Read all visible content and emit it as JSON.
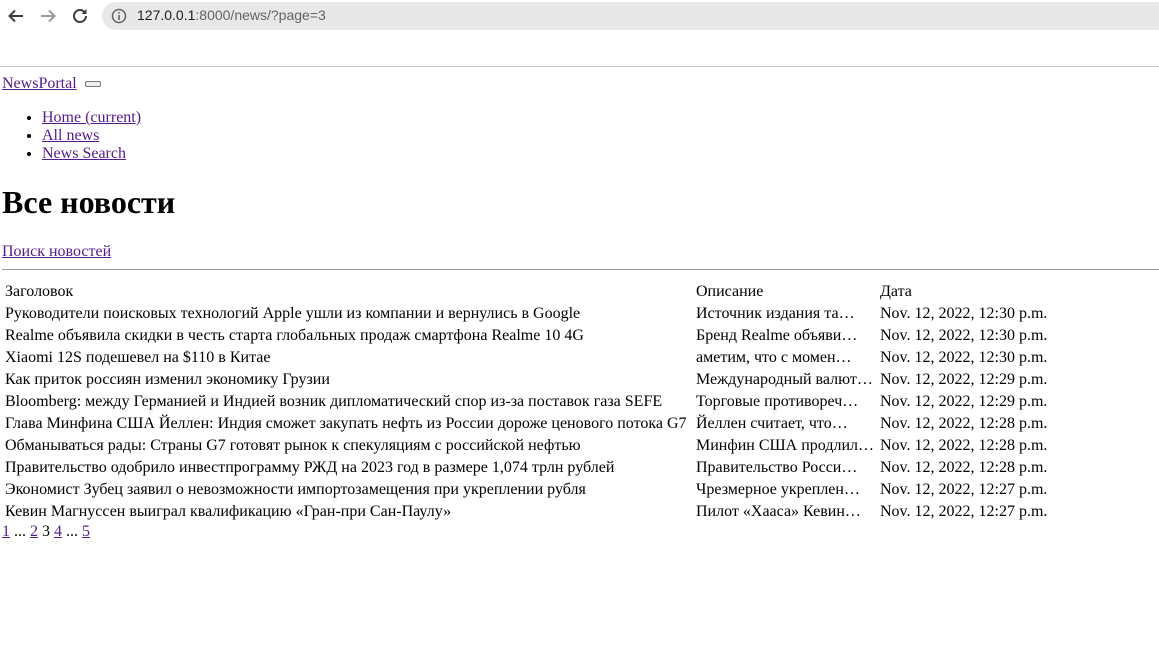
{
  "browser": {
    "url_host": "127.0.0.1",
    "url_path": ":8000/news/?page=3"
  },
  "navbar": {
    "brand": "NewsPortal",
    "items": [
      {
        "label": "Home (current)"
      },
      {
        "label": "All news"
      },
      {
        "label": "News Search"
      }
    ]
  },
  "main": {
    "title": "Все новости",
    "search_link": "Поиск новостей"
  },
  "table": {
    "headers": [
      "Заголовок",
      "Описание",
      "Дата"
    ],
    "rows": [
      {
        "title": "Руководители поисковых технологий Apple ушли из компании и вернулись в Google",
        "desc": "Источник издания та…",
        "date": "Nov. 12, 2022, 12:30 p.m."
      },
      {
        "title": "Realme объявила скидки в честь старта глобальных продаж смартфона Realme 10 4G",
        "desc": "Бренд Realme объяви…",
        "date": "Nov. 12, 2022, 12:30 p.m."
      },
      {
        "title": "Xiaomi 12S подешевел на $110 в Китае",
        "desc": "аметим, что с момен…",
        "date": "Nov. 12, 2022, 12:30 p.m."
      },
      {
        "title": "Как приток россиян изменил экономику Грузии",
        "desc": "Международный валют…",
        "date": "Nov. 12, 2022, 12:29 p.m."
      },
      {
        "title": "Bloomberg: между Германией и Индией возник дипломатический спор из-за поставок газа SEFE",
        "desc": "Торговые противореч…",
        "date": "Nov. 12, 2022, 12:29 p.m."
      },
      {
        "title": "Глава Минфина США Йеллен: Индия сможет закупать нефть из России дороже ценового потока G7",
        "desc": "Йеллен считает, что…",
        "date": "Nov. 12, 2022, 12:28 p.m."
      },
      {
        "title": "Обманываться рады: Страны G7 готовят рынок к спекуляциям с российской нефтью",
        "desc": "Минфин США продлил …",
        "date": "Nov. 12, 2022, 12:28 p.m."
      },
      {
        "title": "Правительство одобрило инвестпрограмму РЖД на 2023 год в размере 1,074 трлн рублей",
        "desc": "Правительство Росси…",
        "date": "Nov. 12, 2022, 12:28 p.m."
      },
      {
        "title": "Экономист Зубец заявил о невозможности импортозамещения при укреплении рубля",
        "desc": "Чрезмерное укреплен…",
        "date": "Nov. 12, 2022, 12:27 p.m."
      },
      {
        "title": "Кевин Магнуссен выиграл квалификацию «Гран-при Сан-Паулу»",
        "desc": "Пилот «Хааса» Кевин…",
        "date": "Nov. 12, 2022, 12:27 p.m."
      }
    ]
  },
  "pagination": {
    "first": "1",
    "ellipsis_left": "...",
    "prev": "2",
    "current": "3",
    "next": "4",
    "ellipsis_right": "...",
    "last": "5"
  }
}
